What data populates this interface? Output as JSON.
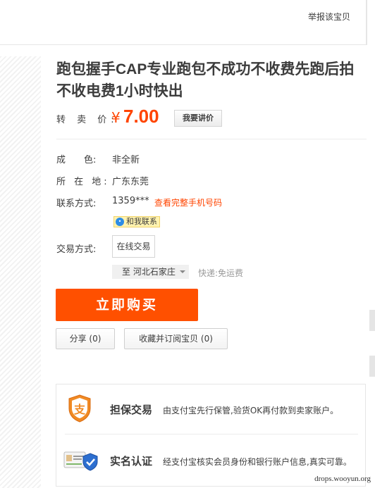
{
  "topbar": {
    "report_label": "举报该宝贝"
  },
  "item": {
    "title": "跑包握手CAP专业跑包不成功不收费先跑后拍不收电费1小时快出",
    "price_label": "转 卖 价:",
    "price_currency": "¥",
    "price_value": "7.00",
    "bargain_label": "我要讲价"
  },
  "details": {
    "condition_label": "成     色:",
    "condition_value": "非全新",
    "location_label": "所 在 地:",
    "location_value": "广东东莞",
    "contact_label": "联系方式:",
    "contact_phone": "1359***",
    "contact_link": "查看完整手机号码",
    "chat_label": "和我联系",
    "trade_label": "交易方式:",
    "trade_value": "在线交易",
    "destination": "至 河北石家庄",
    "shipping_note": "快递:免运费"
  },
  "actions": {
    "buy_label": "立即购买",
    "share_label": "分享 (0)",
    "favorite_label": "收藏并订阅宝贝 (0)"
  },
  "guarantees": [
    {
      "title": "担保交易",
      "desc": "由支付宝先行保管,验货OK再付款到卖家账户。",
      "icon": "alipay-icon"
    },
    {
      "title": "实名认证",
      "desc": "经支付宝核实会员身份和银行账户信息,真实可靠。",
      "icon": "verified-id-icon"
    }
  ],
  "watermark": "drops.wooyun.org",
  "colors": {
    "accent": "#ff4400",
    "buy_button": "#ff5000",
    "chat_badge": "#fff3b0"
  }
}
